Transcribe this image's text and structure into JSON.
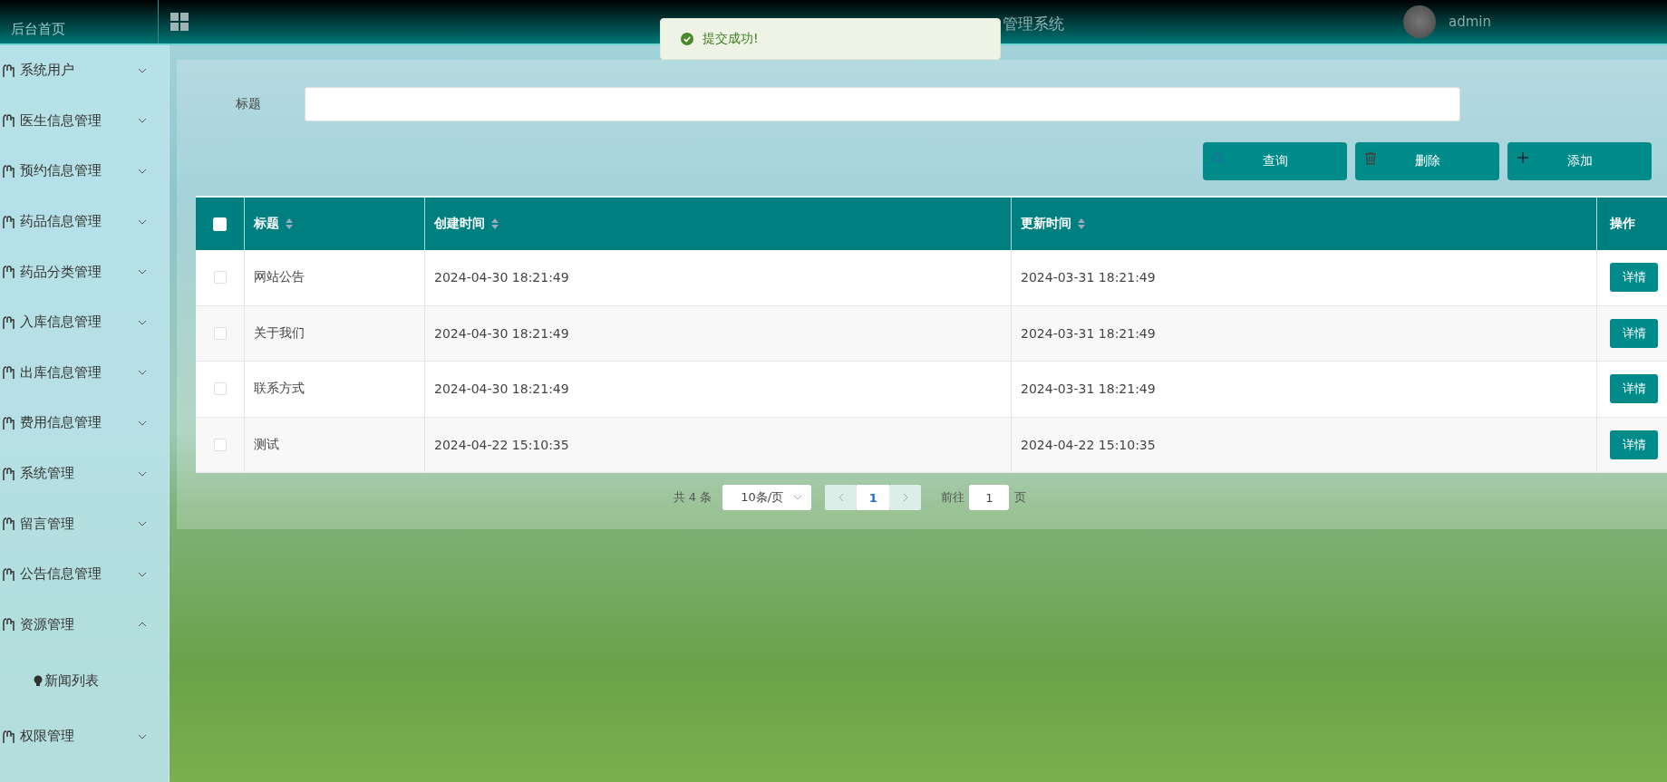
{
  "header": {
    "home_link": "后台首页",
    "title_visible": "管理系统",
    "user": "admin"
  },
  "toast": {
    "kind": "success",
    "message": "提交成功!"
  },
  "sidebar": {
    "items": [
      {
        "label": "系统用户",
        "expanded": false
      },
      {
        "label": "医生信息管理",
        "expanded": false
      },
      {
        "label": "预约信息管理",
        "expanded": false
      },
      {
        "label": "药品信息管理",
        "expanded": false
      },
      {
        "label": "药品分类管理",
        "expanded": false
      },
      {
        "label": "入库信息管理",
        "expanded": false
      },
      {
        "label": "出库信息管理",
        "expanded": false
      },
      {
        "label": "费用信息管理",
        "expanded": false
      },
      {
        "label": "系统管理",
        "expanded": false
      },
      {
        "label": "留言管理",
        "expanded": false
      },
      {
        "label": "公告信息管理",
        "expanded": false
      },
      {
        "label": "资源管理",
        "expanded": true,
        "children": [
          {
            "label": "新闻列表"
          }
        ]
      },
      {
        "label": "权限管理",
        "expanded": false
      }
    ]
  },
  "search": {
    "label": "标题"
  },
  "buttons": [
    {
      "kind": "search",
      "label": "查询"
    },
    {
      "kind": "delete",
      "label": "删除"
    },
    {
      "kind": "add",
      "label": "添加"
    }
  ],
  "table": {
    "select_all_checked": false,
    "columns": [
      {
        "label": "标题",
        "sortable": true
      },
      {
        "label": "创建时间",
        "sortable": true
      },
      {
        "label": "更新时间",
        "sortable": true
      },
      {
        "label": "操作",
        "sortable": false
      }
    ],
    "rows": [
      {
        "checked": false,
        "cells": [
          "网站公告",
          "2024-04-30 18:21:49",
          "2024-03-31 18:21:49"
        ],
        "action": "详情"
      },
      {
        "checked": false,
        "cells": [
          "关于我们",
          "2024-04-30 18:21:49",
          "2024-03-31 18:21:49"
        ],
        "action": "详情"
      },
      {
        "checked": false,
        "cells": [
          "联系方式",
          "2024-04-30 18:21:49",
          "2024-03-31 18:21:49"
        ],
        "action": "详情"
      },
      {
        "checked": false,
        "cells": [
          "测试",
          "2024-04-22 15:10:35",
          "2024-04-22 15:10:35"
        ],
        "action": "详情"
      }
    ]
  },
  "pagination": {
    "total": "共 4 条",
    "page_size": "10条/页",
    "current_page": "1",
    "goto_label": "前往",
    "goto_value": "1",
    "goto_suffix": "页"
  }
}
